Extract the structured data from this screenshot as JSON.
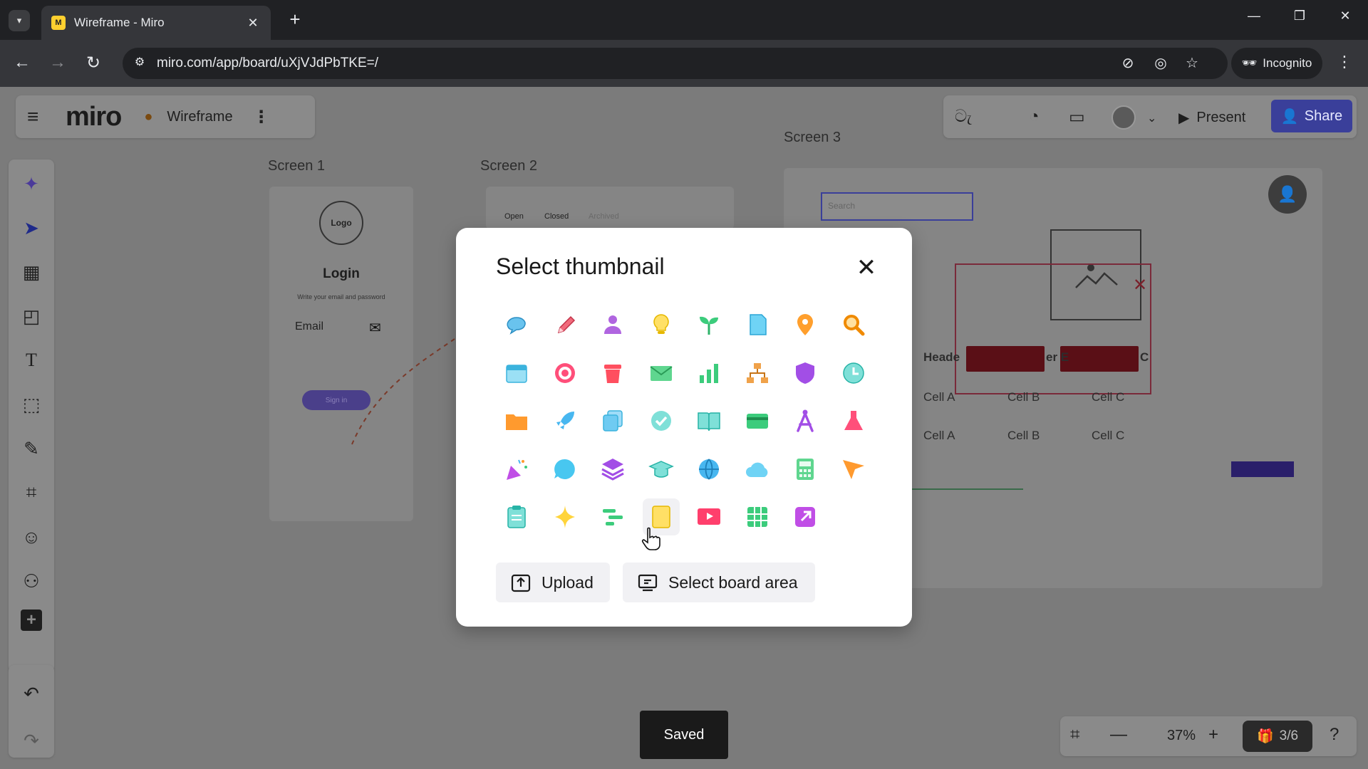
{
  "browser": {
    "tab_title": "Wireframe - Miro",
    "tab_close": "✕",
    "new_tab": "+",
    "url": "miro.com/app/board/uXjVJdPbTKE=/",
    "incognito_label": "Incognito"
  },
  "header": {
    "logo": "miro",
    "board_name": "Wireframe",
    "present_label": "Present",
    "share_label": "Share"
  },
  "board": {
    "screen1": {
      "label": "Screen 1",
      "logo_text": "Logo",
      "title": "Login",
      "subtitle": "Write your email and password",
      "email_label": "Email",
      "button_label": "Sign in"
    },
    "screen2": {
      "label": "Screen 2",
      "tabs": [
        "Open",
        "Closed",
        "Archived"
      ]
    },
    "screen3": {
      "label": "Screen 3",
      "search_placeholder": "Search",
      "dialog_close": "✕",
      "header_cells": [
        "Heade",
        "er E",
        "C"
      ],
      "row1": [
        "Cell A",
        "Cell B",
        "Cell C"
      ],
      "row2": [
        "Cell A",
        "Cell B",
        "Cell C"
      ]
    }
  },
  "modal": {
    "title": "Select thumbnail",
    "close": "✕",
    "upload_label": "Upload",
    "select_area_label": "Select board area",
    "icons": [
      "speech-bubble-icon",
      "pencil-icon",
      "person-icon",
      "lightbulb-icon",
      "sprout-icon",
      "document-icon",
      "location-pin-icon",
      "magnifier-icon",
      "calendar-icon",
      "target-icon",
      "trash-icon",
      "envelope-icon",
      "bar-chart-icon",
      "org-chart-icon",
      "shield-icon",
      "clock-icon",
      "folder-icon",
      "rocket-icon",
      "copy-icon",
      "check-circle-icon",
      "book-icon",
      "credit-card-icon",
      "compass-icon",
      "flask-icon",
      "party-popper-icon",
      "chat-bubble-icon",
      "layers-icon",
      "graduation-cap-icon",
      "globe-icon",
      "cloud-icon",
      "calculator-icon",
      "cursor-arrow-icon",
      "clipboard-icon",
      "sparkle-icon",
      "timeline-icon",
      "sticky-note-icon",
      "video-icon",
      "grid-table-icon",
      "external-link-icon"
    ]
  },
  "status": {
    "saved_label": "Saved",
    "zoom": "37%",
    "pages": "3/6"
  }
}
